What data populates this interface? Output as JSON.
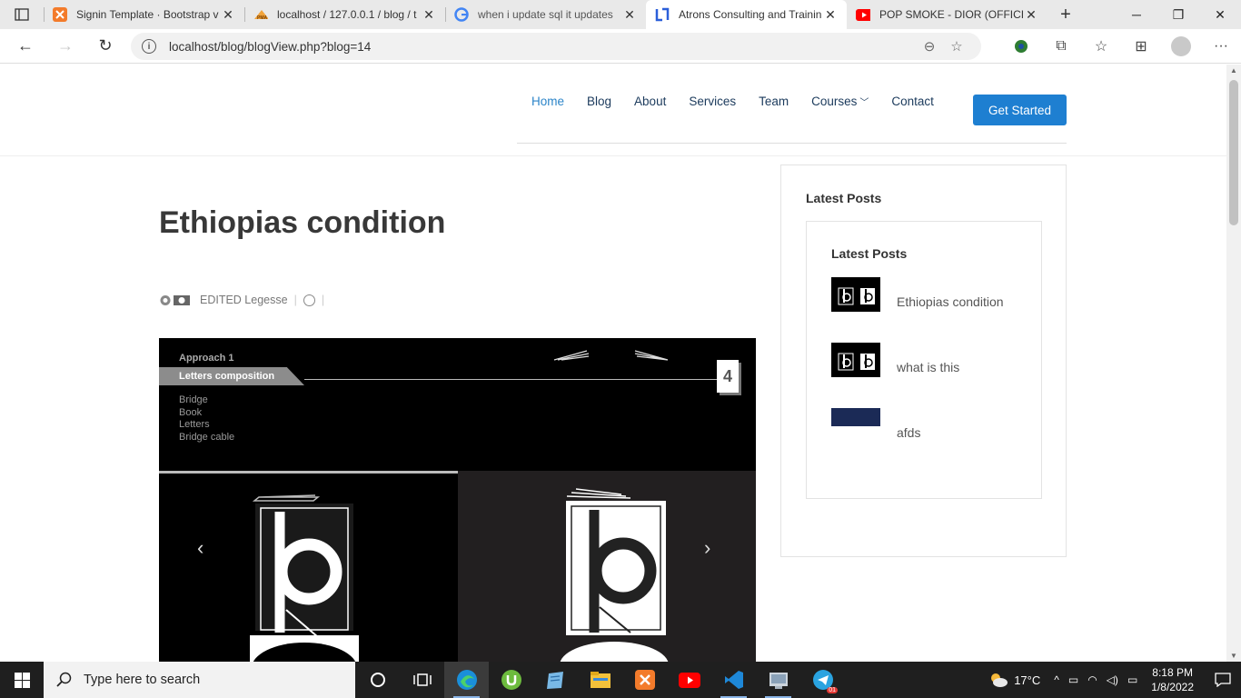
{
  "browser": {
    "tabs": [
      {
        "title": "Signin Template · Bootstrap v",
        "favicon": "xampp-icon"
      },
      {
        "title": "localhost / 127.0.0.1 / blog / t",
        "favicon": "phpmyadmin-icon"
      },
      {
        "title": "when i update sql it updates",
        "favicon": "google-icon"
      },
      {
        "title": "Atrons Consulting and Trainin",
        "favicon": "site-icon",
        "active": true
      },
      {
        "title": "POP SMOKE - DIOR (OFFICIA",
        "favicon": "youtube-icon"
      }
    ],
    "address_url": "localhost/blog/blogView.php?blog=14"
  },
  "site": {
    "nav": [
      {
        "label": "Home",
        "active": true
      },
      {
        "label": "Blog"
      },
      {
        "label": "About"
      },
      {
        "label": "Services"
      },
      {
        "label": "Team"
      },
      {
        "label": "Courses",
        "dropdown": true
      },
      {
        "label": "Contact"
      }
    ],
    "cta_label": "Get Started"
  },
  "post": {
    "title": "Ethiopias condition",
    "author": "EDITED Legesse",
    "date": "",
    "hero": {
      "approach": "Approach 1",
      "ribbon": "Letters composition",
      "number": "4",
      "list": [
        "Bridge",
        "Book",
        "Letters",
        "Bridge cable"
      ]
    }
  },
  "sidebar": {
    "outer_title": "Latest Posts",
    "inner_title": "Latest Posts",
    "posts": [
      {
        "title": "Ethiopias condition",
        "thumb": "dark"
      },
      {
        "title": "what is this",
        "thumb": "dark"
      },
      {
        "title": "afds",
        "thumb": "navy"
      }
    ]
  },
  "taskbar": {
    "search_placeholder": "Type here to search",
    "weather": "17°C",
    "time": "8:18 PM",
    "date": "1/8/2022",
    "telegram_badge": "01"
  },
  "colors": {
    "nav_text": "#1b3a5c",
    "nav_active": "#2c85c9",
    "cta_bg": "#1e7fd1",
    "taskbar_bg": "#1f1f1f"
  }
}
